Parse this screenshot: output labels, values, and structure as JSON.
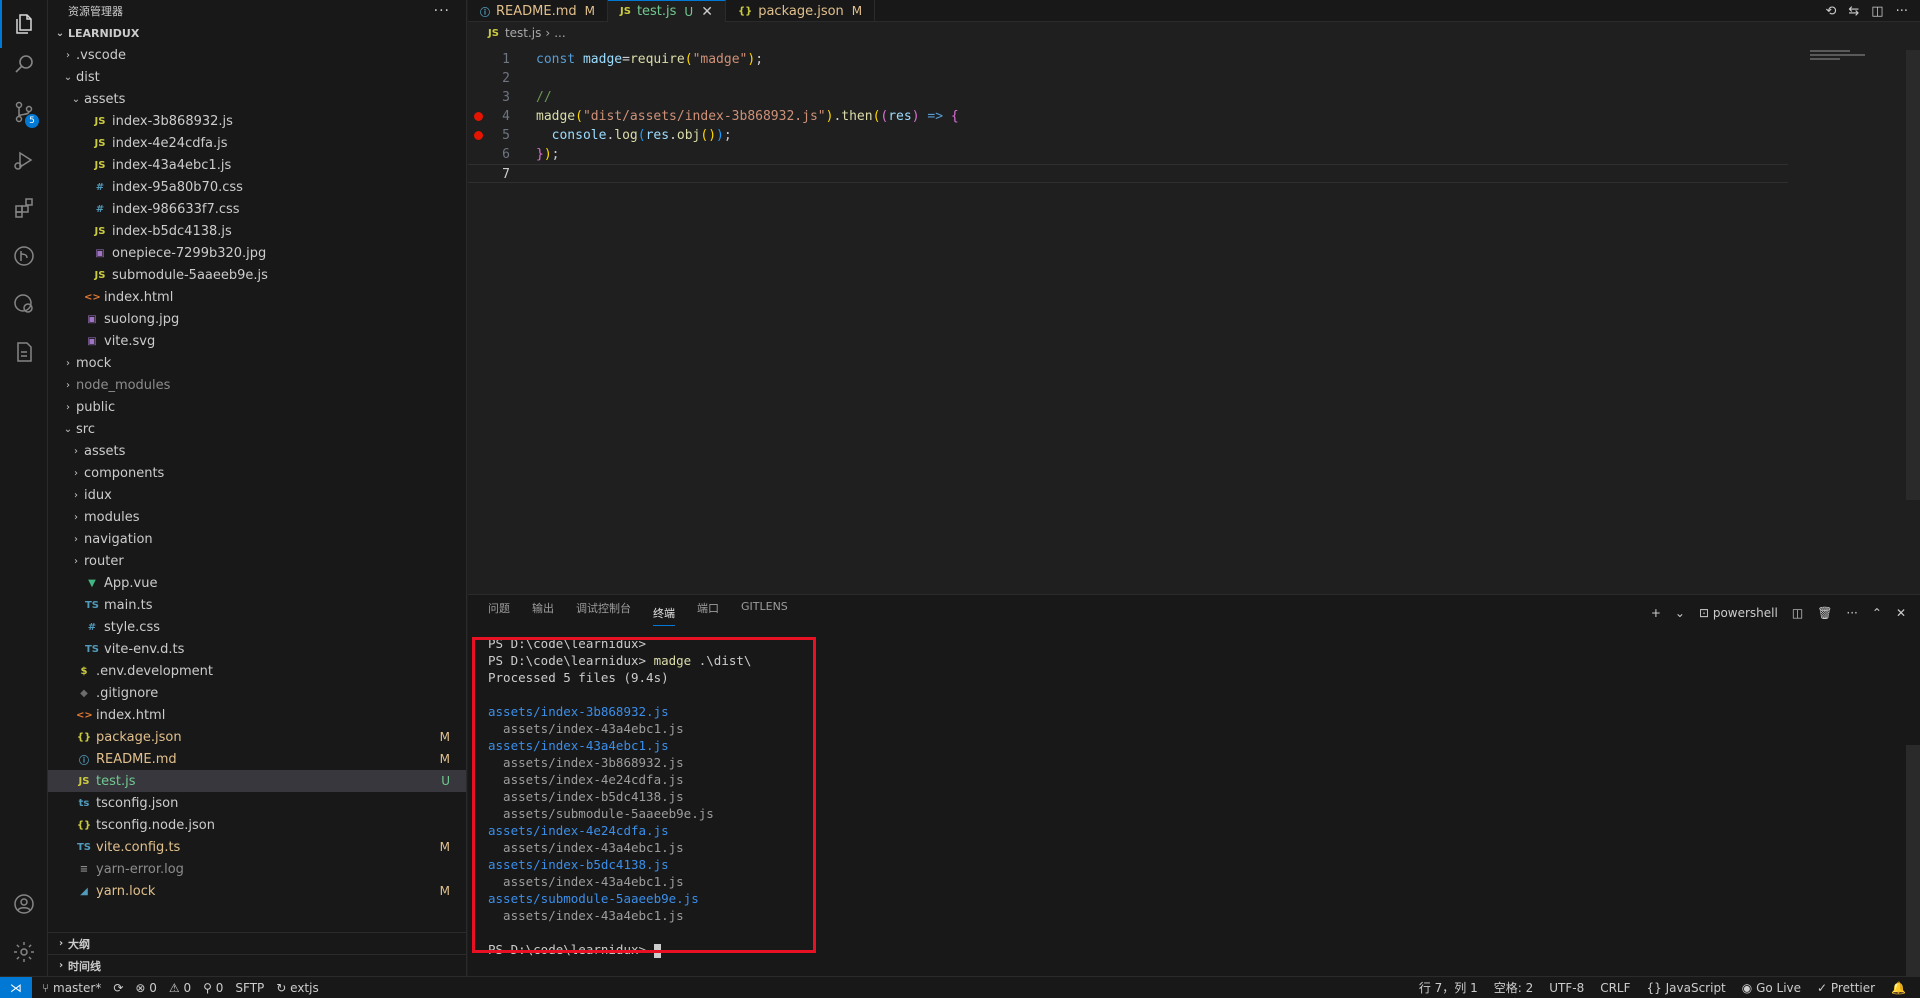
{
  "explorer": {
    "title": "资源管理器",
    "more": "···",
    "root": "LEARNIDUX",
    "items": [
      {
        "depth": 1,
        "chev": "›",
        "icon": "",
        "iclass": "",
        "name": ".vscode",
        "status": "",
        "sclass": ""
      },
      {
        "depth": 1,
        "chev": "⌄",
        "icon": "",
        "iclass": "",
        "name": "dist",
        "status": "",
        "sclass": ""
      },
      {
        "depth": 2,
        "chev": "⌄",
        "icon": "",
        "iclass": "",
        "name": "assets",
        "status": "",
        "sclass": ""
      },
      {
        "depth": 3,
        "chev": "",
        "icon": "JS",
        "iclass": "i-js",
        "name": "index-3b868932.js",
        "status": "",
        "sclass": ""
      },
      {
        "depth": 3,
        "chev": "",
        "icon": "JS",
        "iclass": "i-js",
        "name": "index-4e24cdfa.js",
        "status": "",
        "sclass": ""
      },
      {
        "depth": 3,
        "chev": "",
        "icon": "JS",
        "iclass": "i-js",
        "name": "index-43a4ebc1.js",
        "status": "",
        "sclass": ""
      },
      {
        "depth": 3,
        "chev": "",
        "icon": "#",
        "iclass": "i-css",
        "name": "index-95a80b70.css",
        "status": "",
        "sclass": ""
      },
      {
        "depth": 3,
        "chev": "",
        "icon": "#",
        "iclass": "i-css",
        "name": "index-986633f7.css",
        "status": "",
        "sclass": ""
      },
      {
        "depth": 3,
        "chev": "",
        "icon": "JS",
        "iclass": "i-js",
        "name": "index-b5dc4138.js",
        "status": "",
        "sclass": ""
      },
      {
        "depth": 3,
        "chev": "",
        "icon": "▣",
        "iclass": "i-img",
        "name": "onepiece-7299b320.jpg",
        "status": "",
        "sclass": ""
      },
      {
        "depth": 3,
        "chev": "",
        "icon": "JS",
        "iclass": "i-js",
        "name": "submodule-5aaeeb9e.js",
        "status": "",
        "sclass": ""
      },
      {
        "depth": 2,
        "chev": "",
        "icon": "<>",
        "iclass": "i-html",
        "name": "index.html",
        "status": "",
        "sclass": ""
      },
      {
        "depth": 2,
        "chev": "",
        "icon": "▣",
        "iclass": "i-img",
        "name": "suolong.jpg",
        "status": "",
        "sclass": ""
      },
      {
        "depth": 2,
        "chev": "",
        "icon": "▣",
        "iclass": "i-img",
        "name": "vite.svg",
        "status": "",
        "sclass": ""
      },
      {
        "depth": 1,
        "chev": "›",
        "icon": "",
        "iclass": "",
        "name": "mock",
        "status": "",
        "sclass": ""
      },
      {
        "depth": 1,
        "chev": "›",
        "icon": "",
        "iclass": "",
        "name": "node_modules",
        "status": "",
        "sclass": "ign"
      },
      {
        "depth": 1,
        "chev": "›",
        "icon": "",
        "iclass": "",
        "name": "public",
        "status": "",
        "sclass": ""
      },
      {
        "depth": 1,
        "chev": "⌄",
        "icon": "",
        "iclass": "",
        "name": "src",
        "status": "",
        "sclass": ""
      },
      {
        "depth": 2,
        "chev": "›",
        "icon": "",
        "iclass": "",
        "name": "assets",
        "status": "",
        "sclass": ""
      },
      {
        "depth": 2,
        "chev": "›",
        "icon": "",
        "iclass": "",
        "name": "components",
        "status": "",
        "sclass": ""
      },
      {
        "depth": 2,
        "chev": "›",
        "icon": "",
        "iclass": "",
        "name": "idux",
        "status": "",
        "sclass": ""
      },
      {
        "depth": 2,
        "chev": "›",
        "icon": "",
        "iclass": "",
        "name": "modules",
        "status": "",
        "sclass": ""
      },
      {
        "depth": 2,
        "chev": "›",
        "icon": "",
        "iclass": "",
        "name": "navigation",
        "status": "",
        "sclass": ""
      },
      {
        "depth": 2,
        "chev": "›",
        "icon": "",
        "iclass": "",
        "name": "router",
        "status": "",
        "sclass": ""
      },
      {
        "depth": 2,
        "chev": "",
        "icon": "▼",
        "iclass": "i-vue",
        "name": "App.vue",
        "status": "",
        "sclass": ""
      },
      {
        "depth": 2,
        "chev": "",
        "icon": "TS",
        "iclass": "i-ts",
        "name": "main.ts",
        "status": "",
        "sclass": ""
      },
      {
        "depth": 2,
        "chev": "",
        "icon": "#",
        "iclass": "i-css",
        "name": "style.css",
        "status": "",
        "sclass": ""
      },
      {
        "depth": 2,
        "chev": "",
        "icon": "TS",
        "iclass": "i-ts",
        "name": "vite-env.d.ts",
        "status": "",
        "sclass": ""
      },
      {
        "depth": 1,
        "chev": "",
        "icon": "$",
        "iclass": "i-env",
        "name": ".env.development",
        "status": "",
        "sclass": ""
      },
      {
        "depth": 1,
        "chev": "",
        "icon": "◆",
        "iclass": "i-git",
        "name": ".gitignore",
        "status": "",
        "sclass": ""
      },
      {
        "depth": 1,
        "chev": "",
        "icon": "<>",
        "iclass": "i-html",
        "name": "index.html",
        "status": "",
        "sclass": ""
      },
      {
        "depth": 1,
        "chev": "",
        "icon": "{}",
        "iclass": "i-json",
        "name": "package.json",
        "status": "M",
        "sclass": "mod"
      },
      {
        "depth": 1,
        "chev": "",
        "icon": "ⓘ",
        "iclass": "i-md",
        "name": "README.md",
        "status": "M",
        "sclass": "mod"
      },
      {
        "depth": 1,
        "chev": "",
        "icon": "JS",
        "iclass": "i-js",
        "name": "test.js",
        "status": "U",
        "sclass": "untracked",
        "selected": true
      },
      {
        "depth": 1,
        "chev": "",
        "icon": "ts",
        "iclass": "i-ts",
        "name": "tsconfig.json",
        "status": "",
        "sclass": ""
      },
      {
        "depth": 1,
        "chev": "",
        "icon": "{}",
        "iclass": "i-json",
        "name": "tsconfig.node.json",
        "status": "",
        "sclass": ""
      },
      {
        "depth": 1,
        "chev": "",
        "icon": "TS",
        "iclass": "i-ts",
        "name": "vite.config.ts",
        "status": "M",
        "sclass": "mod"
      },
      {
        "depth": 1,
        "chev": "",
        "icon": "≡",
        "iclass": "i-log",
        "name": "yarn-error.log",
        "status": "",
        "sclass": "ign"
      },
      {
        "depth": 1,
        "chev": "",
        "icon": "◢",
        "iclass": "i-yarn",
        "name": "yarn.lock",
        "status": "M",
        "sclass": "mod"
      }
    ],
    "outline": "大纲",
    "timeline": "时间线"
  },
  "tabs": [
    {
      "icon": "ⓘ",
      "iclass": "i-md",
      "label": "README.md",
      "status": "M",
      "sclass": "mod",
      "active": false
    },
    {
      "icon": "JS",
      "iclass": "i-js",
      "label": "test.js",
      "status": "U",
      "sclass": "untracked",
      "active": true
    },
    {
      "icon": "{}",
      "iclass": "i-json",
      "label": "package.json",
      "status": "M",
      "sclass": "mod",
      "active": false
    }
  ],
  "breadcrumb": {
    "icon": "JS",
    "file": "test.js",
    "sep": "›",
    "rest": "..."
  },
  "code": [
    {
      "n": "1",
      "bp": false,
      "tokens": [
        [
          "k",
          "const "
        ],
        [
          "v",
          "madge"
        ],
        [
          "",
          "="
        ],
        [
          "f",
          "require"
        ],
        [
          "p1",
          "("
        ],
        [
          "s",
          "\"madge\""
        ],
        [
          "p1",
          ")"
        ],
        [
          "",
          ";"
        ]
      ]
    },
    {
      "n": "2",
      "bp": false,
      "tokens": []
    },
    {
      "n": "3",
      "bp": false,
      "tokens": [
        [
          "cm",
          "//"
        ]
      ]
    },
    {
      "n": "4",
      "bp": true,
      "tokens": [
        [
          "f",
          "madge"
        ],
        [
          "p1",
          "("
        ],
        [
          "s",
          "\"dist/assets/index-3b868932.js\""
        ],
        [
          "p1",
          ")"
        ],
        [
          "",
          "."
        ],
        [
          "f",
          "then"
        ],
        [
          "p1",
          "("
        ],
        [
          "p2",
          "("
        ],
        [
          "v",
          "res"
        ],
        [
          "p2",
          ")"
        ],
        [
          "",
          " "
        ],
        [
          "k",
          "=>"
        ],
        [
          "",
          " "
        ],
        [
          "p2",
          "{"
        ]
      ]
    },
    {
      "n": "5",
      "bp": true,
      "tokens": [
        [
          "",
          "  "
        ],
        [
          "v",
          "console"
        ],
        [
          "",
          "."
        ],
        [
          "f",
          "log"
        ],
        [
          "p3",
          "("
        ],
        [
          "v",
          "res"
        ],
        [
          "",
          "."
        ],
        [
          "f",
          "obj"
        ],
        [
          "p1",
          "()"
        ],
        [
          "p3",
          ")"
        ],
        [
          "",
          ";"
        ]
      ]
    },
    {
      "n": "6",
      "bp": false,
      "tokens": [
        [
          "p2",
          "}"
        ],
        [
          "p1",
          ")"
        ],
        [
          "",
          ";"
        ]
      ]
    },
    {
      "n": "7",
      "bp": false,
      "tokens": [],
      "current": true
    }
  ],
  "panel": {
    "tabs": [
      {
        "label": "问题",
        "active": false
      },
      {
        "label": "输出",
        "active": false
      },
      {
        "label": "调试控制台",
        "active": false
      },
      {
        "label": "终端",
        "active": true
      },
      {
        "label": "端口",
        "active": false
      },
      {
        "label": "GITLENS",
        "active": false
      }
    ],
    "add": "+",
    "dropdown": "⌄",
    "shell": "powershell",
    "more": "···"
  },
  "terminal": {
    "lines": [
      {
        "cls": "t-path",
        "text": "PS D:\\code\\learnidux>"
      },
      {
        "cls": "t-path",
        "text": "PS D:\\code\\learnidux> ",
        "cmd": "madge",
        "rest": " .\\dist\\"
      },
      {
        "cls": "t-path",
        "text": "Processed 5 files (9.4s)"
      },
      {
        "cls": "",
        "text": " "
      },
      {
        "cls": "t-dep",
        "text": "assets/index-3b868932.js"
      },
      {
        "cls": "t-sub",
        "text": "  assets/index-43a4ebc1.js"
      },
      {
        "cls": "t-dep",
        "text": "assets/index-43a4ebc1.js"
      },
      {
        "cls": "t-sub",
        "text": "  assets/index-3b868932.js"
      },
      {
        "cls": "t-sub",
        "text": "  assets/index-4e24cdfa.js"
      },
      {
        "cls": "t-sub",
        "text": "  assets/index-b5dc4138.js"
      },
      {
        "cls": "t-sub",
        "text": "  assets/submodule-5aaeeb9e.js"
      },
      {
        "cls": "t-dep",
        "text": "assets/index-4e24cdfa.js"
      },
      {
        "cls": "t-sub",
        "text": "  assets/index-43a4ebc1.js"
      },
      {
        "cls": "t-dep",
        "text": "assets/index-b5dc4138.js"
      },
      {
        "cls": "t-sub",
        "text": "  assets/index-43a4ebc1.js"
      },
      {
        "cls": "t-dep",
        "text": "assets/submodule-5aaeeb9e.js"
      },
      {
        "cls": "t-sub",
        "text": "  assets/index-43a4ebc1.js"
      },
      {
        "cls": "",
        "text": " "
      },
      {
        "cls": "t-path",
        "text": "PS D:\\code\\learnidux> ",
        "cursor": true
      }
    ]
  },
  "status": {
    "remote": "⋊",
    "branch": "master*",
    "sync": "⟳",
    "errors": "⊗ 0",
    "warnings": "⚠ 0",
    "ports": "⚲ 0",
    "sftp": "SFTP",
    "extjs": "extjs",
    "position": "行 7，列 1",
    "spaces": "空格: 2",
    "encoding": "UTF-8",
    "eol": "CRLF",
    "language": "JavaScript",
    "golive": "Go Live",
    "prettier": "Prettier"
  },
  "colors": {
    "accent": "#0078d4",
    "highlight_box": "#e81123",
    "breakpoint": "#e51400"
  }
}
